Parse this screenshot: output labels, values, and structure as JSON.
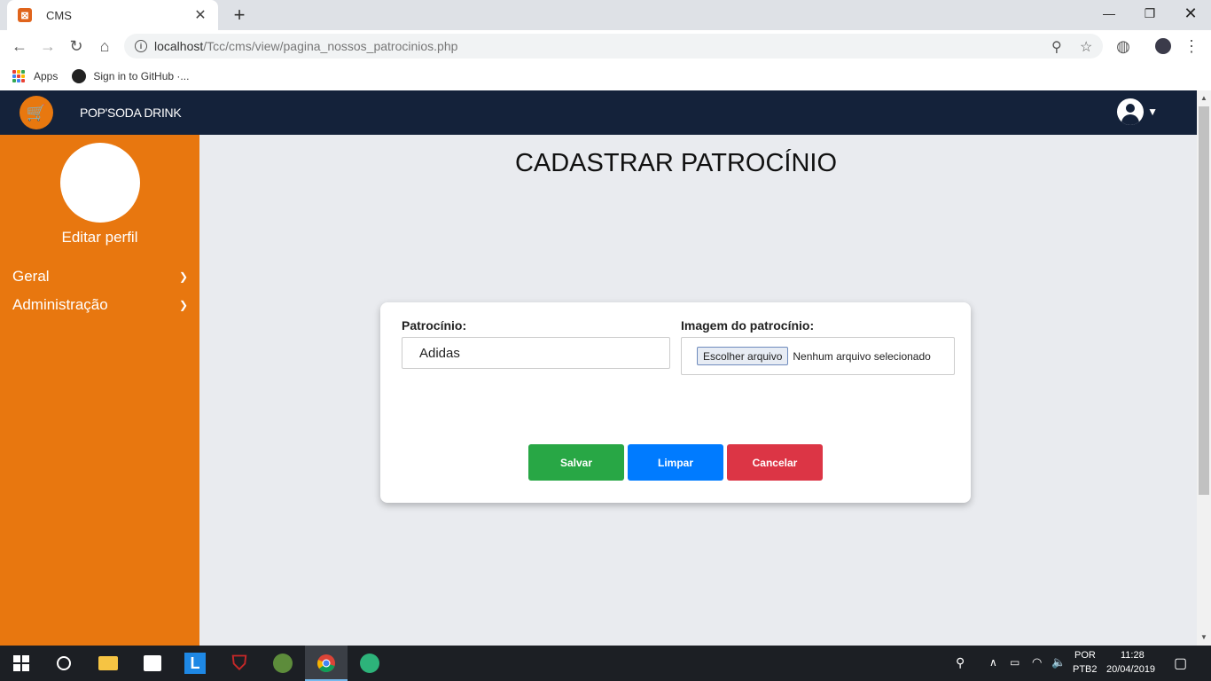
{
  "browser": {
    "tab_title": "CMS",
    "url_host": "localhost",
    "url_path": "/Tcc/cms/view/pagina_nossos_patrocinios.php",
    "bookmarks": [
      {
        "label": "Apps",
        "icon": "apps-grid-icon"
      },
      {
        "label": "Sign in to GitHub ·...",
        "icon": "github-icon"
      }
    ]
  },
  "app": {
    "brand": "POP'SODA DRINK",
    "brand_color": "#14223a",
    "accent_color": "#e8770f"
  },
  "sidebar": {
    "edit_profile": "Editar perfil",
    "items": [
      {
        "label": "Geral"
      },
      {
        "label": "Administração"
      }
    ]
  },
  "main": {
    "title": "CADASTRAR PATROCÍNIO",
    "form": {
      "sponsor_label": "Patrocínio:",
      "sponsor_value": "Adidas",
      "image_label": "Imagem do patrocínio:",
      "file_button": "Escolher arquivo",
      "file_status": "Nenhum arquivo selecionado",
      "buttons": {
        "save": "Salvar",
        "clear": "Limpar",
        "cancel": "Cancelar"
      },
      "button_colors": {
        "save": "#28a745",
        "clear": "#007bff",
        "cancel": "#dc3545"
      }
    }
  },
  "taskbar": {
    "lang_top": "POR",
    "lang_bottom": "PTB2",
    "time": "11:28",
    "date": "20/04/2019"
  }
}
